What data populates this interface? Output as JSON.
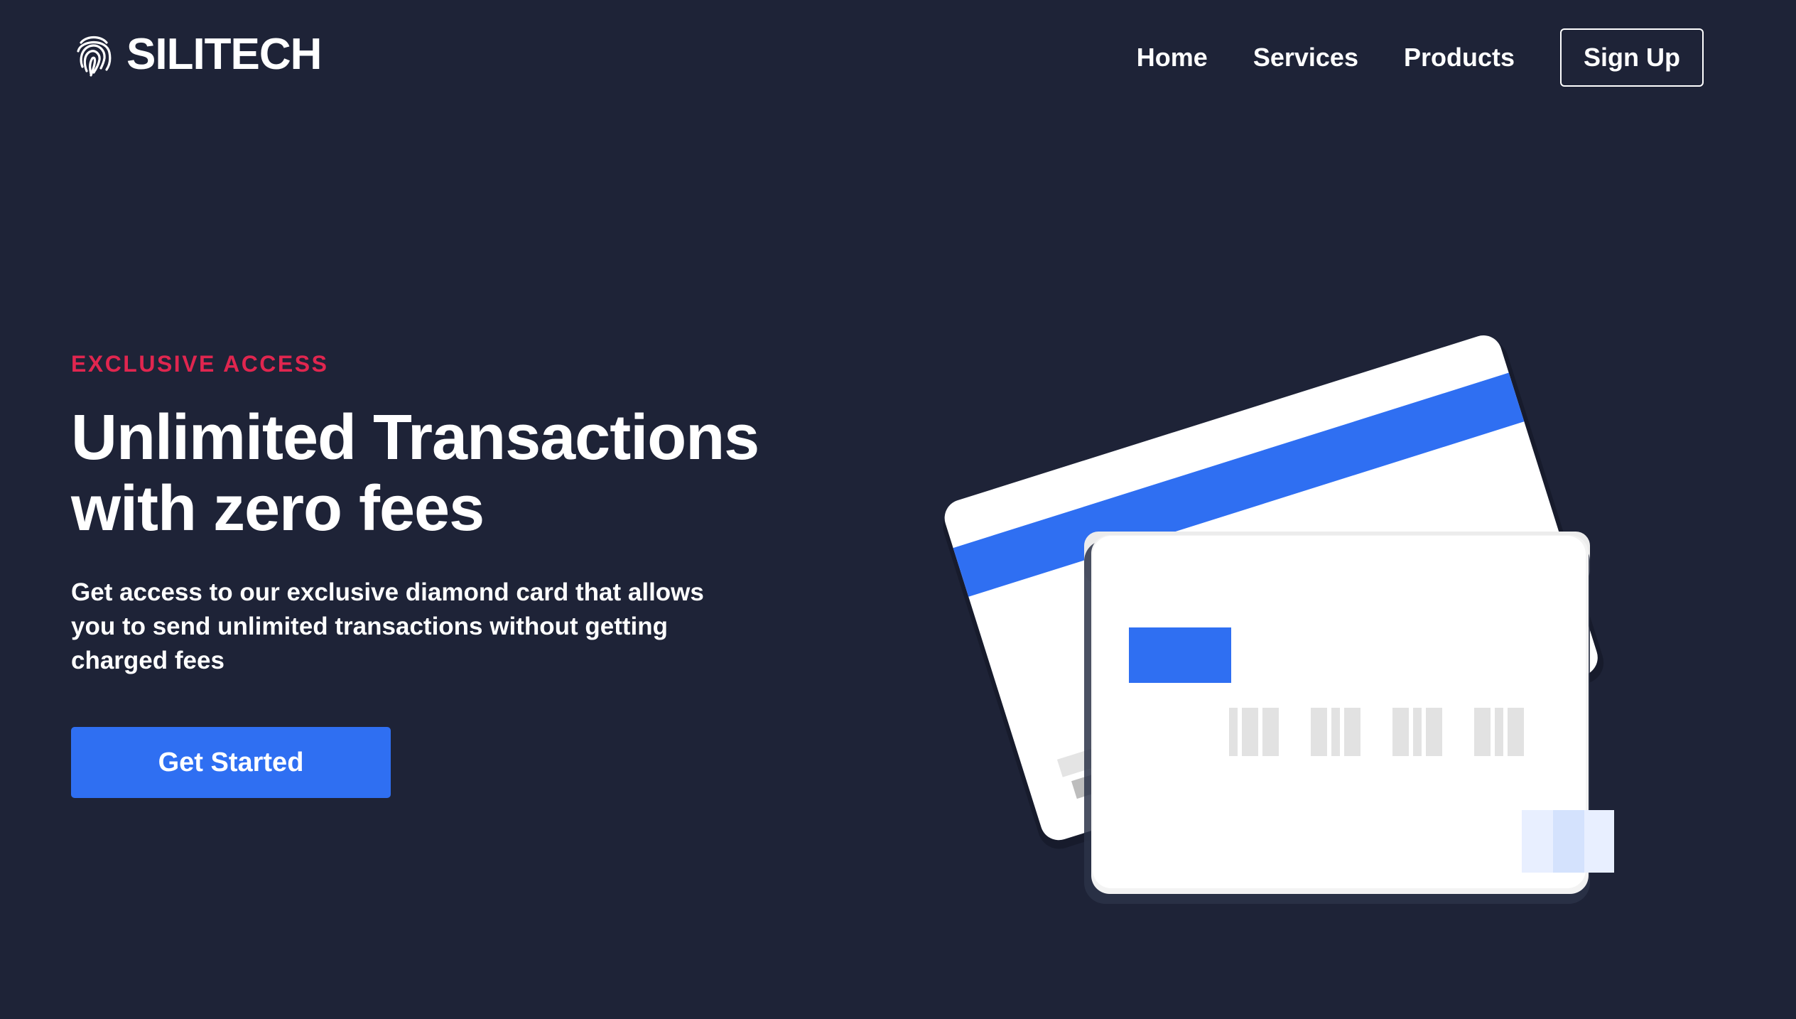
{
  "brand": {
    "name": "SILITECH",
    "logo_icon": "fingerprint-icon"
  },
  "nav": {
    "links": [
      "Home",
      "Services",
      "Products"
    ],
    "signup_label": "Sign Up"
  },
  "hero": {
    "eyebrow": "EXCLUSIVE ACCESS",
    "headline_line1": "Unlimited Transactions",
    "headline_line2": "with zero fees",
    "description": "Get access to our exclusive diamond card that allows you to send unlimited transactions without getting charged fees",
    "cta_label": "Get Started"
  },
  "colors": {
    "background": "#1e2337",
    "accent": "#2f6ff2",
    "eyebrow": "#e0264f",
    "text": "#ffffff"
  }
}
